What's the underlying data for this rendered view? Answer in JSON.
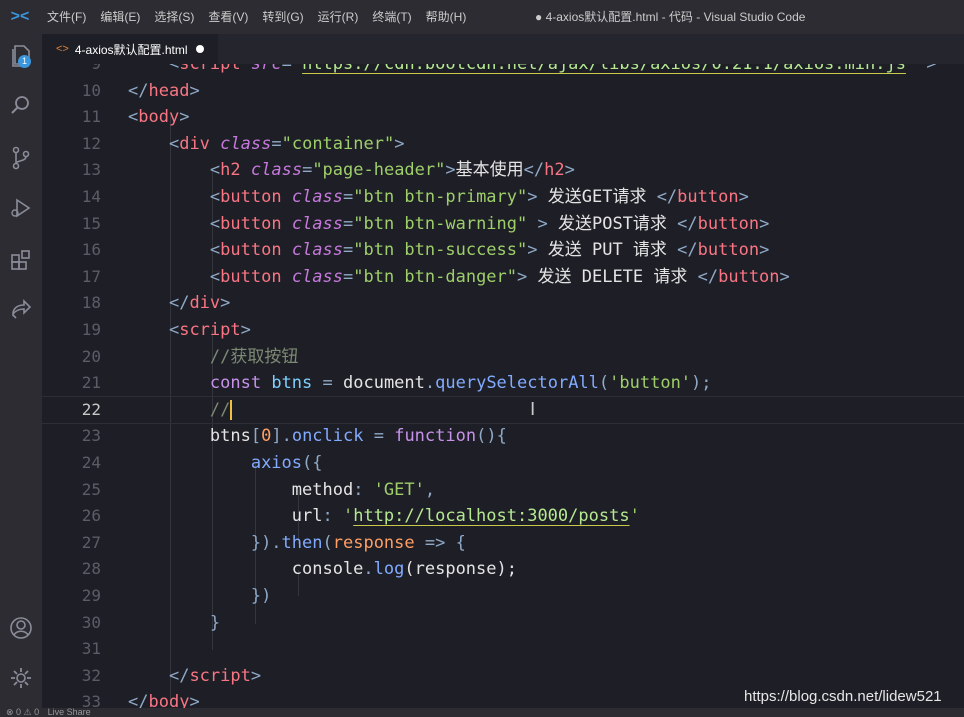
{
  "app": {
    "logo": "><",
    "window_title": "● 4-axios默认配置.html - 代码 - Visual Studio Code"
  },
  "menu": [
    "文件(F)",
    "编辑(E)",
    "选择(S)",
    "查看(V)",
    "转到(G)",
    "运行(R)",
    "终端(T)",
    "帮助(H)"
  ],
  "activity_bar": {
    "icons": [
      "explorer-icon",
      "search-icon",
      "source-control-icon",
      "run-debug-icon",
      "extensions-icon",
      "live-share-icon",
      "account-icon",
      "settings-gear-icon"
    ],
    "explorer_badge": "1"
  },
  "tab": {
    "icon": "<>",
    "label": "4-axios默认配置.html",
    "modified": true
  },
  "editor": {
    "current_line": "22",
    "lines": [
      {
        "n": "9",
        "tokens": [
          [
            "    ",
            "t-txt"
          ],
          [
            "<",
            "t-pun"
          ],
          [
            "script",
            "t-tag"
          ],
          [
            " src",
            "t-attr"
          ],
          [
            "=",
            "t-pun"
          ],
          [
            "\"",
            "t-str"
          ],
          [
            "https://cdn.bootcdn.net/ajax/libs/axios/0.21.1/axios.min.js",
            "t-link"
          ],
          [
            "\" ",
            "t-str"
          ],
          [
            ">",
            "t-pun"
          ]
        ]
      },
      {
        "n": "10",
        "tokens": [
          [
            "</",
            "t-pun"
          ],
          [
            "head",
            "t-tag"
          ],
          [
            ">",
            "t-pun"
          ]
        ]
      },
      {
        "n": "11",
        "tokens": [
          [
            "<",
            "t-pun"
          ],
          [
            "body",
            "t-tag"
          ],
          [
            ">",
            "t-pun"
          ]
        ]
      },
      {
        "n": "12",
        "tokens": [
          [
            "    ",
            "t-txt"
          ],
          [
            "<",
            "t-pun"
          ],
          [
            "div",
            "t-tag"
          ],
          [
            " ",
            "t-txt"
          ],
          [
            "class",
            "t-attr"
          ],
          [
            "=",
            "t-pun"
          ],
          [
            "\"container\"",
            "t-str"
          ],
          [
            ">",
            "t-pun"
          ]
        ]
      },
      {
        "n": "13",
        "tokens": [
          [
            "        ",
            "t-txt"
          ],
          [
            "<",
            "t-pun"
          ],
          [
            "h2",
            "t-tag"
          ],
          [
            " ",
            "t-txt"
          ],
          [
            "class",
            "t-attr"
          ],
          [
            "=",
            "t-pun"
          ],
          [
            "\"page-header\"",
            "t-str"
          ],
          [
            ">",
            "t-pun"
          ],
          [
            "基本使用",
            "t-txt"
          ],
          [
            "</",
            "t-pun"
          ],
          [
            "h2",
            "t-tag"
          ],
          [
            ">",
            "t-pun"
          ]
        ]
      },
      {
        "n": "14",
        "tokens": [
          [
            "        ",
            "t-txt"
          ],
          [
            "<",
            "t-pun"
          ],
          [
            "button",
            "t-tag"
          ],
          [
            " ",
            "t-txt"
          ],
          [
            "class",
            "t-attr"
          ],
          [
            "=",
            "t-pun"
          ],
          [
            "\"btn btn-primary\"",
            "t-str"
          ],
          [
            ">",
            "t-pun"
          ],
          [
            " 发送GET请求 ",
            "t-txt"
          ],
          [
            "</",
            "t-pun"
          ],
          [
            "button",
            "t-tag"
          ],
          [
            ">",
            "t-pun"
          ]
        ]
      },
      {
        "n": "15",
        "tokens": [
          [
            "        ",
            "t-txt"
          ],
          [
            "<",
            "t-pun"
          ],
          [
            "button",
            "t-tag"
          ],
          [
            " ",
            "t-txt"
          ],
          [
            "class",
            "t-attr"
          ],
          [
            "=",
            "t-pun"
          ],
          [
            "\"btn btn-warning\"",
            "t-str"
          ],
          [
            " >",
            "t-pun"
          ],
          [
            " 发送POST请求 ",
            "t-txt"
          ],
          [
            "</",
            "t-pun"
          ],
          [
            "button",
            "t-tag"
          ],
          [
            ">",
            "t-pun"
          ]
        ]
      },
      {
        "n": "16",
        "tokens": [
          [
            "        ",
            "t-txt"
          ],
          [
            "<",
            "t-pun"
          ],
          [
            "button",
            "t-tag"
          ],
          [
            " ",
            "t-txt"
          ],
          [
            "class",
            "t-attr"
          ],
          [
            "=",
            "t-pun"
          ],
          [
            "\"btn btn-success\"",
            "t-str"
          ],
          [
            ">",
            "t-pun"
          ],
          [
            " 发送 PUT 请求 ",
            "t-txt"
          ],
          [
            "</",
            "t-pun"
          ],
          [
            "button",
            "t-tag"
          ],
          [
            ">",
            "t-pun"
          ]
        ]
      },
      {
        "n": "17",
        "tokens": [
          [
            "        ",
            "t-txt"
          ],
          [
            "<",
            "t-pun"
          ],
          [
            "button",
            "t-tag"
          ],
          [
            " ",
            "t-txt"
          ],
          [
            "class",
            "t-attr"
          ],
          [
            "=",
            "t-pun"
          ],
          [
            "\"btn btn-danger\"",
            "t-str"
          ],
          [
            ">",
            "t-pun"
          ],
          [
            " 发送 DELETE 请求 ",
            "t-txt"
          ],
          [
            "</",
            "t-pun"
          ],
          [
            "button",
            "t-tag"
          ],
          [
            ">",
            "t-pun"
          ]
        ]
      },
      {
        "n": "18",
        "tokens": [
          [
            "    ",
            "t-txt"
          ],
          [
            "</",
            "t-pun"
          ],
          [
            "div",
            "t-tag"
          ],
          [
            ">",
            "t-pun"
          ]
        ]
      },
      {
        "n": "19",
        "tokens": [
          [
            "    ",
            "t-txt"
          ],
          [
            "<",
            "t-pun"
          ],
          [
            "script",
            "t-tag"
          ],
          [
            ">",
            "t-pun"
          ]
        ]
      },
      {
        "n": "20",
        "tokens": [
          [
            "        ",
            "t-txt"
          ],
          [
            "//获取按钮",
            "t-com"
          ]
        ]
      },
      {
        "n": "21",
        "tokens": [
          [
            "        ",
            "t-txt"
          ],
          [
            "const",
            "t-kw"
          ],
          [
            " ",
            "t-txt"
          ],
          [
            "btns",
            "t-var"
          ],
          [
            " = ",
            "t-pun"
          ],
          [
            "document",
            "t-id"
          ],
          [
            ".",
            "t-pun"
          ],
          [
            "querySelectorAll",
            "t-fn"
          ],
          [
            "(",
            "t-pun"
          ],
          [
            "'button'",
            "t-str"
          ],
          [
            ");",
            "t-pun"
          ]
        ]
      },
      {
        "n": "22",
        "tokens": [
          [
            "        ",
            "t-txt"
          ],
          [
            "//",
            "t-com"
          ]
        ],
        "cursor": true
      },
      {
        "n": "23",
        "tokens": [
          [
            "        ",
            "t-txt"
          ],
          [
            "btns",
            "t-id"
          ],
          [
            "[",
            "t-pun"
          ],
          [
            "0",
            "t-num"
          ],
          [
            "].",
            "t-pun"
          ],
          [
            "onclick",
            "t-fn"
          ],
          [
            " = ",
            "t-pun"
          ],
          [
            "function",
            "t-kw"
          ],
          [
            "(){",
            "t-pun"
          ]
        ]
      },
      {
        "n": "24",
        "tokens": [
          [
            "            ",
            "t-txt"
          ],
          [
            "axios",
            "t-fn"
          ],
          [
            "({",
            "t-pun"
          ]
        ]
      },
      {
        "n": "25",
        "tokens": [
          [
            "                ",
            "t-txt"
          ],
          [
            "method",
            "t-id"
          ],
          [
            ": ",
            "t-pun"
          ],
          [
            "'GET'",
            "t-str"
          ],
          [
            ",",
            "t-pun"
          ]
        ]
      },
      {
        "n": "26",
        "tokens": [
          [
            "                ",
            "t-txt"
          ],
          [
            "url",
            "t-id"
          ],
          [
            ": ",
            "t-pun"
          ],
          [
            "'",
            "t-str"
          ],
          [
            "http://localhost:3000/posts",
            "t-link"
          ],
          [
            "'",
            "t-str"
          ]
        ]
      },
      {
        "n": "27",
        "tokens": [
          [
            "            ",
            "t-txt"
          ],
          [
            "}).",
            "t-pun"
          ],
          [
            "then",
            "t-fn"
          ],
          [
            "(",
            "t-pun"
          ],
          [
            "response",
            "t-num"
          ],
          [
            " => {",
            "t-pun"
          ]
        ]
      },
      {
        "n": "28",
        "tokens": [
          [
            "                ",
            "t-txt"
          ],
          [
            "console",
            "t-id"
          ],
          [
            ".",
            "t-pun"
          ],
          [
            "log",
            "t-fn"
          ],
          [
            "(response);",
            "t-id"
          ]
        ]
      },
      {
        "n": "29",
        "tokens": [
          [
            "            ",
            "t-txt"
          ],
          [
            "})",
            "t-pun"
          ]
        ]
      },
      {
        "n": "30",
        "tokens": [
          [
            "        ",
            "t-txt"
          ],
          [
            "}",
            "t-pun"
          ]
        ]
      },
      {
        "n": "31",
        "tokens": []
      },
      {
        "n": "32",
        "tokens": [
          [
            "    ",
            "t-txt"
          ],
          [
            "</",
            "t-pun"
          ],
          [
            "script",
            "t-tag"
          ],
          [
            ">",
            "t-pun"
          ]
        ]
      },
      {
        "n": "33",
        "tokens": [
          [
            "</",
            "t-pun"
          ],
          [
            "body",
            "t-tag"
          ],
          [
            ">",
            "t-pun"
          ]
        ]
      }
    ]
  },
  "watermark": "https://blog.csdn.net/lidew521",
  "statusbar": {
    "problems": "⊗ 0 ⚠ 0",
    "live_share": "Live Share"
  }
}
